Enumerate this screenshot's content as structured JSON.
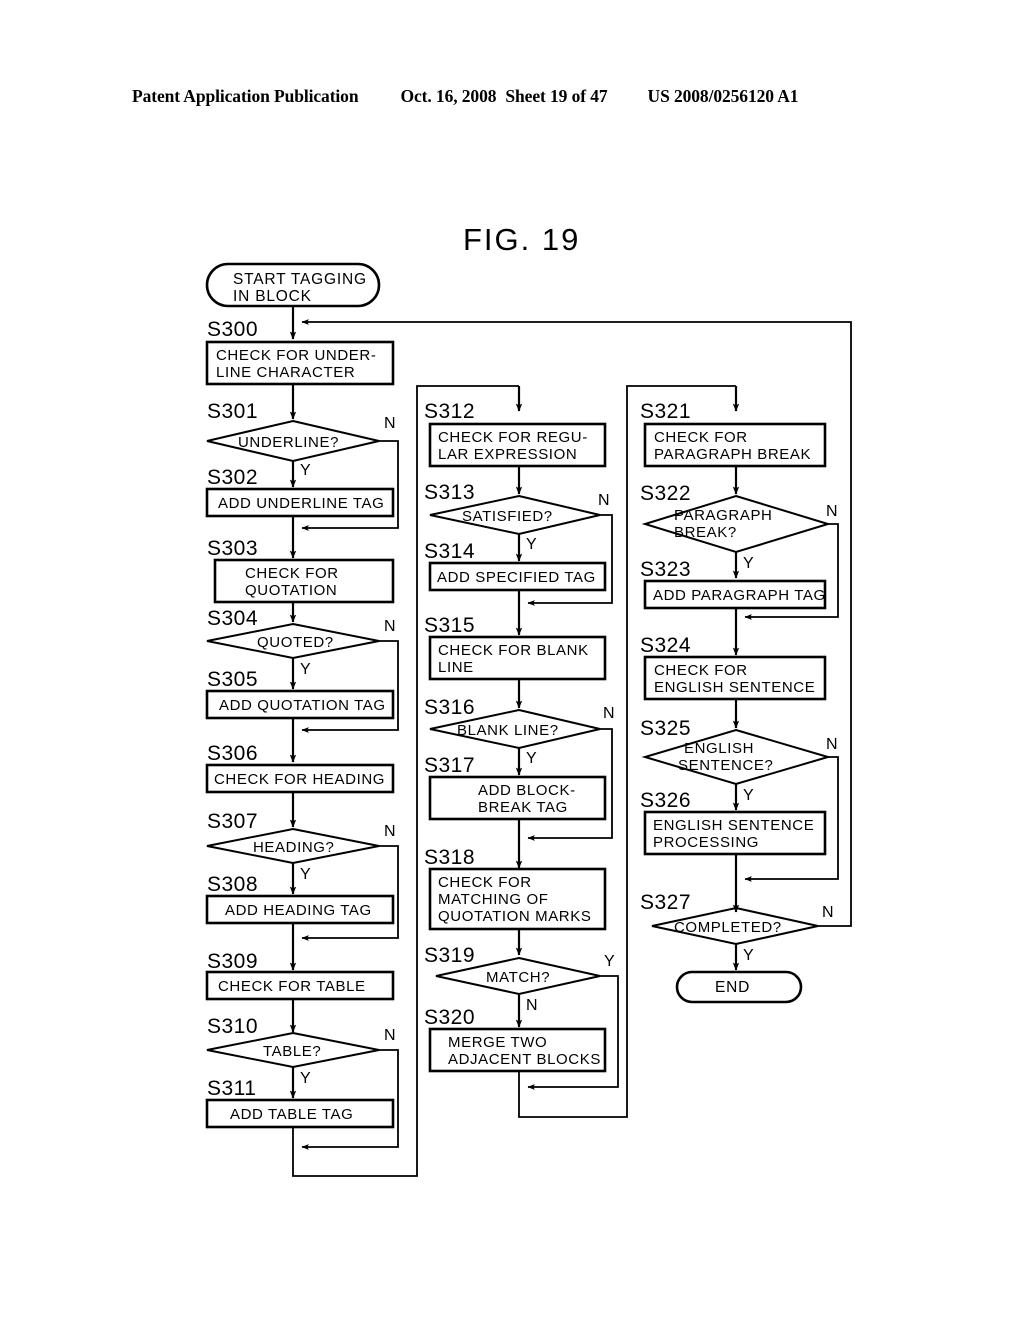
{
  "header": {
    "publication": "Patent Application Publication",
    "date": "Oct. 16, 2008",
    "sheet": "Sheet 19 of 47",
    "number": "US 2008/0256120 A1"
  },
  "figure": {
    "title": "FIG.  19"
  },
  "flowchart": {
    "start_label": "START TAGGING\nIN BLOCK",
    "start_line1": "START TAGGING",
    "start_line2": "IN BLOCK",
    "end_label": "END",
    "yes": "Y",
    "no": "N",
    "columns": [
      {
        "name": "column-1",
        "nodes": [
          {
            "id": "S300",
            "type": "process",
            "lines": [
              "CHECK FOR UNDER-",
              "LINE CHARACTER"
            ]
          },
          {
            "id": "S301",
            "type": "decision",
            "lines": [
              "UNDERLINE?"
            ]
          },
          {
            "id": "S302",
            "type": "process",
            "lines": [
              "ADD UNDERLINE TAG"
            ]
          },
          {
            "id": "S303",
            "type": "process",
            "lines": [
              "CHECK FOR",
              "QUOTATION"
            ]
          },
          {
            "id": "S304",
            "type": "decision",
            "lines": [
              "QUOTED?"
            ]
          },
          {
            "id": "S305",
            "type": "process",
            "lines": [
              "ADD QUOTATION TAG"
            ]
          },
          {
            "id": "S306",
            "type": "process",
            "lines": [
              "CHECK FOR HEADING"
            ]
          },
          {
            "id": "S307",
            "type": "decision",
            "lines": [
              "HEADING?"
            ]
          },
          {
            "id": "S308",
            "type": "process",
            "lines": [
              "ADD HEADING TAG"
            ]
          },
          {
            "id": "S309",
            "type": "process",
            "lines": [
              "CHECK FOR TABLE"
            ]
          },
          {
            "id": "S310",
            "type": "decision",
            "lines": [
              "TABLE?"
            ]
          },
          {
            "id": "S311",
            "type": "process",
            "lines": [
              "ADD TABLE TAG"
            ]
          }
        ]
      },
      {
        "name": "column-2",
        "nodes": [
          {
            "id": "S312",
            "type": "process",
            "lines": [
              "CHECK FOR REGU-",
              "LAR EXPRESSION"
            ]
          },
          {
            "id": "S313",
            "type": "decision",
            "lines": [
              "SATISFIED?"
            ]
          },
          {
            "id": "S314",
            "type": "process",
            "lines": [
              "ADD SPECIFIED TAG"
            ]
          },
          {
            "id": "S315",
            "type": "process",
            "lines": [
              "CHECK FOR BLANK",
              "LINE"
            ]
          },
          {
            "id": "S316",
            "type": "decision",
            "lines": [
              "BLANK LINE?"
            ]
          },
          {
            "id": "S317",
            "type": "process",
            "lines": [
              "ADD BLOCK-",
              "BREAK TAG"
            ]
          },
          {
            "id": "S318",
            "type": "process",
            "lines": [
              "CHECK FOR",
              "MATCHING OF",
              "QUOTATION MARKS"
            ]
          },
          {
            "id": "S319",
            "type": "decision",
            "lines": [
              "MATCH?"
            ]
          },
          {
            "id": "S320",
            "type": "process",
            "lines": [
              "MERGE TWO",
              "ADJACENT BLOCKS"
            ]
          }
        ]
      },
      {
        "name": "column-3",
        "nodes": [
          {
            "id": "S321",
            "type": "process",
            "lines": [
              "CHECK FOR",
              "PARAGRAPH BREAK"
            ]
          },
          {
            "id": "S322",
            "type": "decision",
            "lines": [
              "PARAGRAPH",
              "BREAK?"
            ]
          },
          {
            "id": "S323",
            "type": "process",
            "lines": [
              "ADD PARAGRAPH TAG"
            ]
          },
          {
            "id": "S324",
            "type": "process",
            "lines": [
              "CHECK FOR",
              "ENGLISH SENTENCE"
            ]
          },
          {
            "id": "S325",
            "type": "decision",
            "lines": [
              "ENGLISH",
              "SENTENCE?"
            ]
          },
          {
            "id": "S326",
            "type": "process",
            "lines": [
              "ENGLISH SENTENCE",
              "PROCESSING"
            ]
          },
          {
            "id": "S327",
            "type": "decision",
            "lines": [
              "COMPLETED?"
            ]
          }
        ]
      }
    ]
  },
  "colors": {
    "ink": "#000000",
    "paper": "#ffffff"
  }
}
